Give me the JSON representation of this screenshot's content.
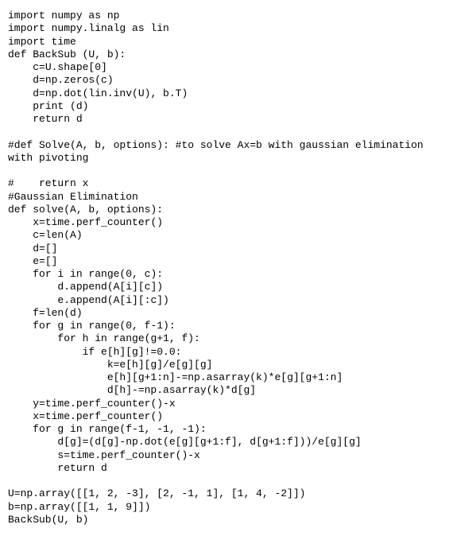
{
  "code": {
    "lines": [
      "import numpy as np",
      "import numpy.linalg as lin",
      "import time",
      "def BackSub (U, b):",
      "    c=U.shape[0]",
      "    d=np.zeros(c)",
      "    d=np.dot(lin.inv(U), b.T)",
      "    print (d)",
      "    return d",
      "",
      "#def Solve(A, b, options): #to solve Ax=b with gaussian elimination with pivoting",
      "",
      "#    return x",
      "#Gaussian Elimination",
      "def solve(A, b, options):",
      "    x=time.perf_counter()",
      "    c=len(A)",
      "    d=[]",
      "    e=[]",
      "    for i in range(0, c):",
      "        d.append(A[i][c])",
      "        e.append(A[i][:c])",
      "    f=len(d)",
      "    for g in range(0, f-1):",
      "        for h in range(g+1, f):",
      "            if e[h][g]!=0.0:",
      "                k=e[h][g]/e[g][g]",
      "                e[h][g+1:n]-=np.asarray(k)*e[g][g+1:n]",
      "                d[h]-=np.asarray(k)*d[g]",
      "    y=time.perf_counter()-x",
      "    x=time.perf_counter()",
      "    for g in range(f-1, -1, -1):",
      "        d[g]=(d[g]-np.dot(e[g][g+1:f], d[g+1:f]))/e[g][g]",
      "        s=time.perf_counter()-x",
      "        return d",
      "",
      "U=np.array([[1, 2, -3], [2, -1, 1], [1, 4, -2]])",
      "b=np.array([[1, 1, 9]])",
      "BackSub(U, b)"
    ]
  }
}
